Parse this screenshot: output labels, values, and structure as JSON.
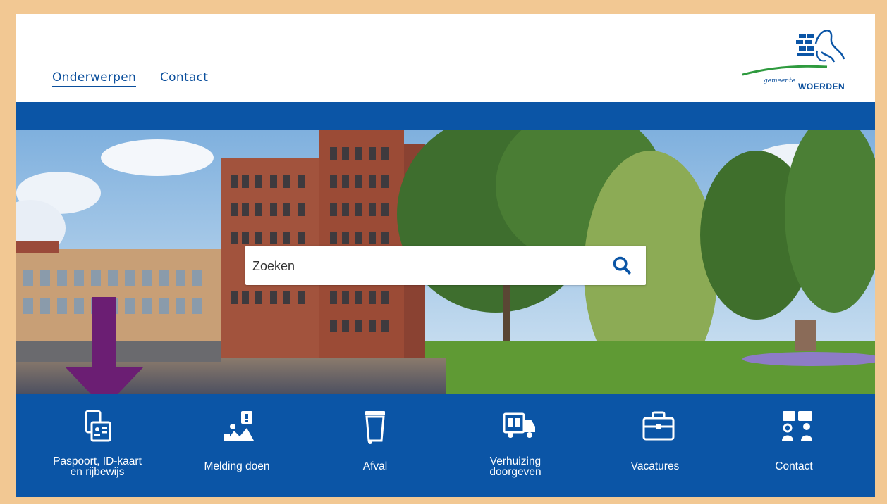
{
  "header": {
    "nav": [
      {
        "label": "Onderwerpen",
        "active": true
      },
      {
        "label": "Contact",
        "active": false
      }
    ],
    "logo": {
      "small": "gemeente",
      "big": "WOERDEN"
    }
  },
  "search": {
    "placeholder": "Zoeken"
  },
  "tiles": [
    {
      "line1": "Paspoort, ID-kaart",
      "line2": "en rijbewijs",
      "icon": "id-card-icon"
    },
    {
      "line1": "Melding doen",
      "line2": "",
      "icon": "report-icon"
    },
    {
      "line1": "Afval",
      "line2": "",
      "icon": "trash-bin-icon"
    },
    {
      "line1": "Verhuizing",
      "line2": "doorgeven",
      "icon": "moving-truck-icon"
    },
    {
      "line1": "Vacatures",
      "line2": "",
      "icon": "briefcase-icon"
    },
    {
      "line1": "Contact",
      "line2": "",
      "icon": "contact-icon"
    }
  ],
  "colors": {
    "brand_blue": "#0b55a6",
    "frame": "#f2c893",
    "arrow": "#6b1e73"
  }
}
